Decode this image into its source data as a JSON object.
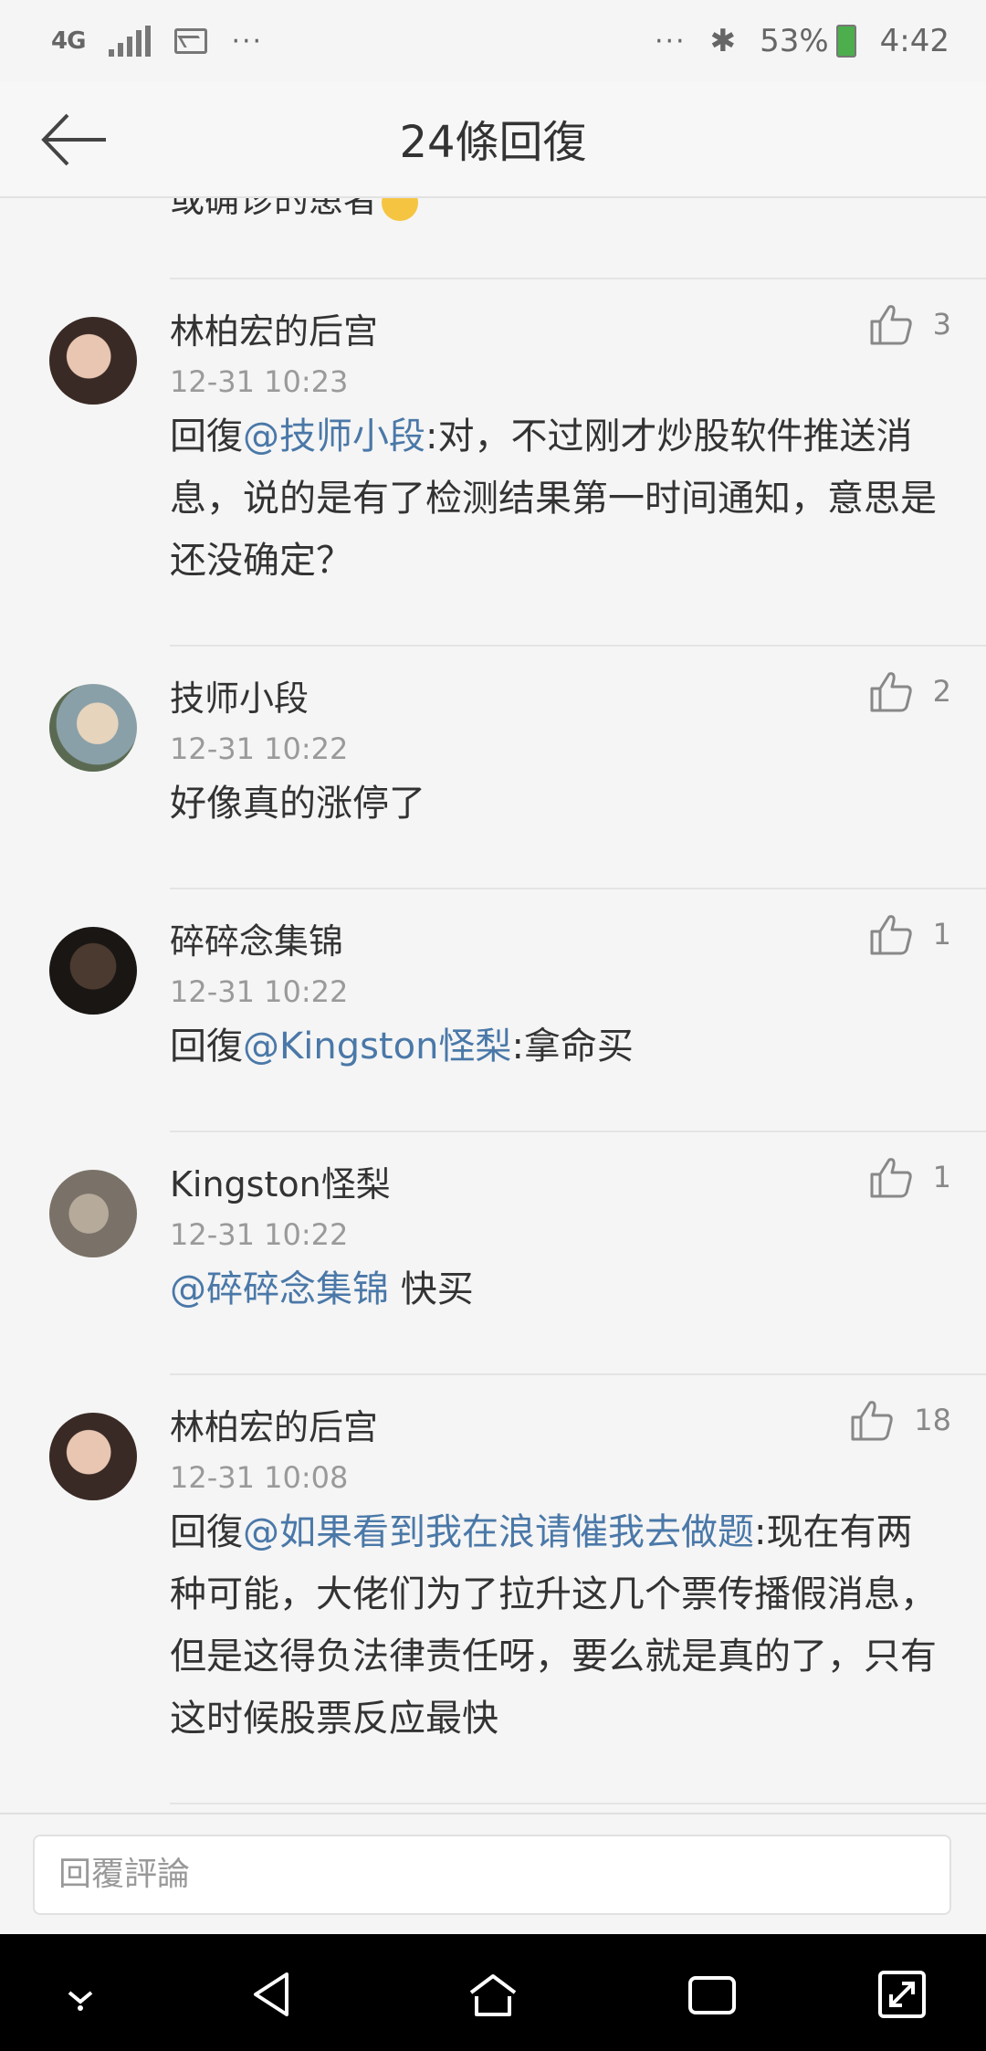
{
  "status_bar": {
    "network": "4G",
    "more": "···",
    "more_right": "···",
    "battery_percent": "53%",
    "time": "4:42"
  },
  "header": {
    "title": "24條回復"
  },
  "partial_text": "或确诊的患者",
  "comments": [
    {
      "user": "林柏宏的后宫",
      "time": "12-31 10:23",
      "likes": "3",
      "prefix": "回復",
      "mention": "@技师小段",
      "text": ":对，不过刚才炒股软件推送消息，说的是有了检测结果第一时间通知，意思是还没确定？"
    },
    {
      "user": "技师小段",
      "time": "12-31 10:22",
      "likes": "2",
      "prefix": "",
      "mention": "",
      "text": "好像真的涨停了"
    },
    {
      "user": "碎碎念集锦",
      "time": "12-31 10:22",
      "likes": "1",
      "prefix": "回復",
      "mention": "@Kingston怪梨",
      "text": ":拿命买"
    },
    {
      "user": "Kingston怪梨",
      "time": "12-31 10:22",
      "likes": "1",
      "prefix": "",
      "mention": "@碎碎念集锦",
      "text": " 快买"
    },
    {
      "user": "林柏宏的后宫",
      "time": "12-31 10:08",
      "likes": "18",
      "prefix": "回復",
      "mention": "@如果看到我在浪请催我去做题",
      "text": ":现在有两种可能，大佬们为了拉升这几个票传播假消息，但是这得负法律责任呀，要么就是真的了，只有这时候股票反应最快"
    }
  ],
  "input": {
    "placeholder": "回覆評論"
  },
  "colors": {
    "mention": "#4a78a8",
    "background": "#f5f5f5",
    "nav_bar": "#000000"
  },
  "icons": [
    "back-arrow-icon",
    "thumbs-up-icon",
    "bluetooth-icon",
    "signal-icon",
    "image-icon",
    "battery-icon",
    "nav-down-icon",
    "nav-back-icon",
    "nav-home-icon",
    "nav-recents-icon",
    "nav-expand-icon"
  ]
}
